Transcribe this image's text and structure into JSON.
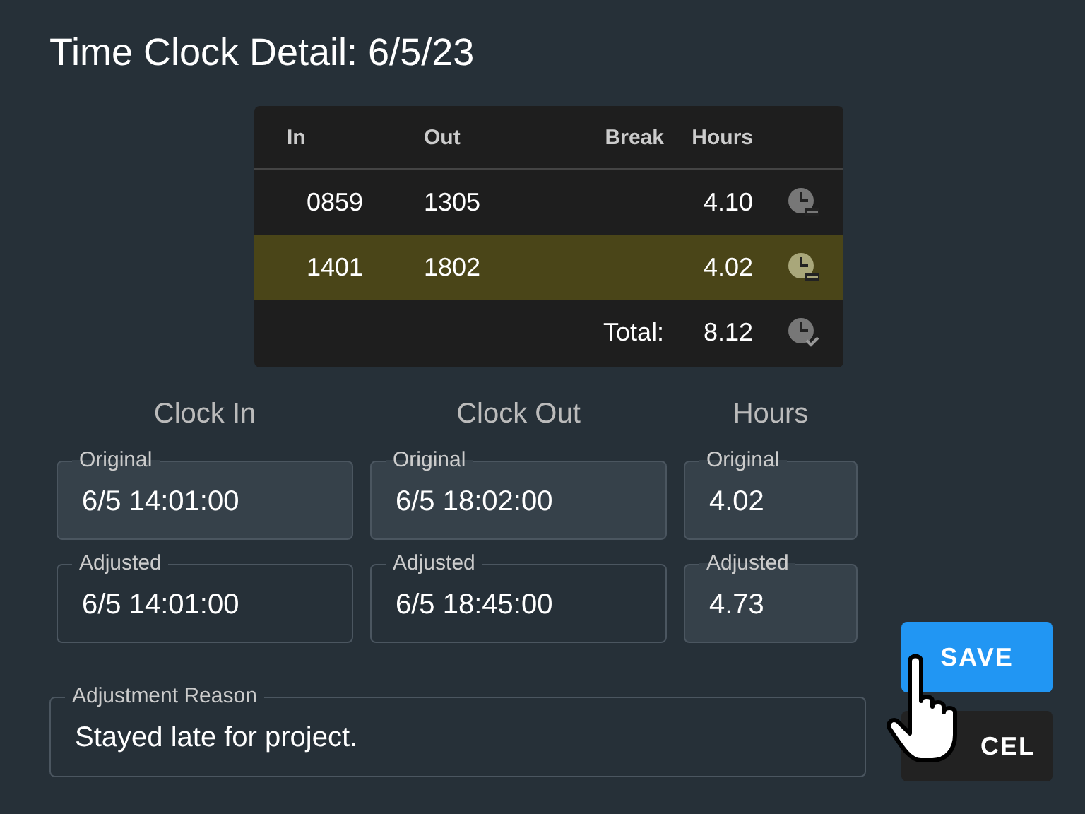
{
  "title": "Time Clock Detail: 6/5/23",
  "table": {
    "columns": [
      "In",
      "Out",
      "Break",
      "Hours"
    ],
    "rows": [
      {
        "in": "0859",
        "out": "1305",
        "hours": "4.10",
        "selected": false,
        "kind": "entry"
      },
      {
        "in": "1401",
        "out": "1802",
        "hours": "4.02",
        "selected": true,
        "kind": "entry"
      },
      {
        "break_time": "Total:",
        "hours": "8.12",
        "selected": false,
        "kind": "total"
      }
    ]
  },
  "editor": {
    "headings": [
      "Clock In",
      "Clock Out",
      "Hours"
    ],
    "fields": [
      {
        "label": "Original",
        "value": "6/5 14:01:00",
        "disabled": true
      },
      {
        "label": "Original",
        "value": "6/5 18:02:00",
        "disabled": true
      },
      {
        "label": "Original",
        "value": "4.02",
        "disabled": true
      },
      {
        "label": "Adjusted",
        "value": "6/5 14:01:00",
        "disabled": false
      },
      {
        "label": "Adjusted",
        "value": "6/5 18:45:00",
        "disabled": false
      },
      {
        "label": "Adjusted",
        "value": "4.73",
        "disabled": true
      }
    ]
  },
  "reason": {
    "label": "Adjustment Reason",
    "value": "Stayed late for project."
  },
  "buttons": [
    {
      "label": "SAVE",
      "kind": "primary"
    },
    {
      "label": "CEL",
      "kind": "secondary"
    }
  ]
}
